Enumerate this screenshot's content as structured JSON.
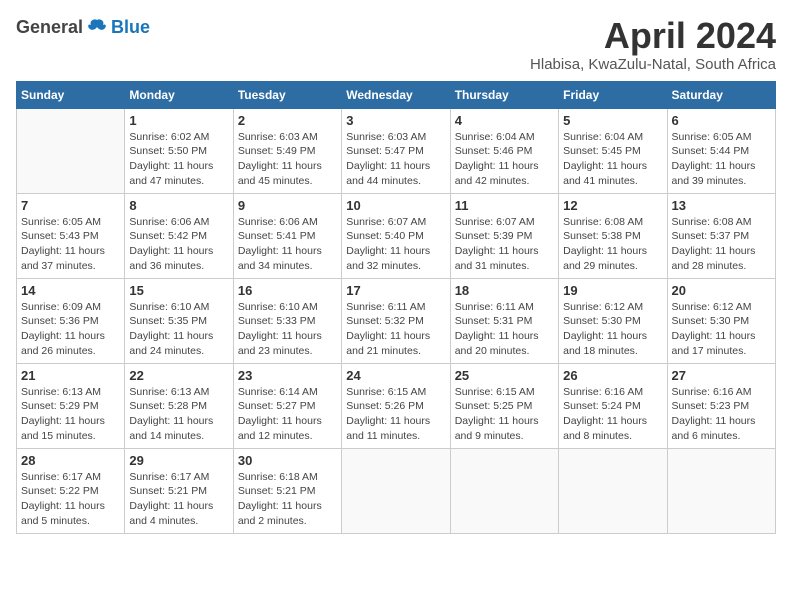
{
  "header": {
    "logo_general": "General",
    "logo_blue": "Blue",
    "month_title": "April 2024",
    "location": "Hlabisa, KwaZulu-Natal, South Africa"
  },
  "days_of_week": [
    "Sunday",
    "Monday",
    "Tuesday",
    "Wednesday",
    "Thursday",
    "Friday",
    "Saturday"
  ],
  "weeks": [
    [
      {
        "day": "",
        "info": ""
      },
      {
        "day": "1",
        "info": "Sunrise: 6:02 AM\nSunset: 5:50 PM\nDaylight: 11 hours\nand 47 minutes."
      },
      {
        "day": "2",
        "info": "Sunrise: 6:03 AM\nSunset: 5:49 PM\nDaylight: 11 hours\nand 45 minutes."
      },
      {
        "day": "3",
        "info": "Sunrise: 6:03 AM\nSunset: 5:47 PM\nDaylight: 11 hours\nand 44 minutes."
      },
      {
        "day": "4",
        "info": "Sunrise: 6:04 AM\nSunset: 5:46 PM\nDaylight: 11 hours\nand 42 minutes."
      },
      {
        "day": "5",
        "info": "Sunrise: 6:04 AM\nSunset: 5:45 PM\nDaylight: 11 hours\nand 41 minutes."
      },
      {
        "day": "6",
        "info": "Sunrise: 6:05 AM\nSunset: 5:44 PM\nDaylight: 11 hours\nand 39 minutes."
      }
    ],
    [
      {
        "day": "7",
        "info": "Sunrise: 6:05 AM\nSunset: 5:43 PM\nDaylight: 11 hours\nand 37 minutes."
      },
      {
        "day": "8",
        "info": "Sunrise: 6:06 AM\nSunset: 5:42 PM\nDaylight: 11 hours\nand 36 minutes."
      },
      {
        "day": "9",
        "info": "Sunrise: 6:06 AM\nSunset: 5:41 PM\nDaylight: 11 hours\nand 34 minutes."
      },
      {
        "day": "10",
        "info": "Sunrise: 6:07 AM\nSunset: 5:40 PM\nDaylight: 11 hours\nand 32 minutes."
      },
      {
        "day": "11",
        "info": "Sunrise: 6:07 AM\nSunset: 5:39 PM\nDaylight: 11 hours\nand 31 minutes."
      },
      {
        "day": "12",
        "info": "Sunrise: 6:08 AM\nSunset: 5:38 PM\nDaylight: 11 hours\nand 29 minutes."
      },
      {
        "day": "13",
        "info": "Sunrise: 6:08 AM\nSunset: 5:37 PM\nDaylight: 11 hours\nand 28 minutes."
      }
    ],
    [
      {
        "day": "14",
        "info": "Sunrise: 6:09 AM\nSunset: 5:36 PM\nDaylight: 11 hours\nand 26 minutes."
      },
      {
        "day": "15",
        "info": "Sunrise: 6:10 AM\nSunset: 5:35 PM\nDaylight: 11 hours\nand 24 minutes."
      },
      {
        "day": "16",
        "info": "Sunrise: 6:10 AM\nSunset: 5:33 PM\nDaylight: 11 hours\nand 23 minutes."
      },
      {
        "day": "17",
        "info": "Sunrise: 6:11 AM\nSunset: 5:32 PM\nDaylight: 11 hours\nand 21 minutes."
      },
      {
        "day": "18",
        "info": "Sunrise: 6:11 AM\nSunset: 5:31 PM\nDaylight: 11 hours\nand 20 minutes."
      },
      {
        "day": "19",
        "info": "Sunrise: 6:12 AM\nSunset: 5:30 PM\nDaylight: 11 hours\nand 18 minutes."
      },
      {
        "day": "20",
        "info": "Sunrise: 6:12 AM\nSunset: 5:30 PM\nDaylight: 11 hours\nand 17 minutes."
      }
    ],
    [
      {
        "day": "21",
        "info": "Sunrise: 6:13 AM\nSunset: 5:29 PM\nDaylight: 11 hours\nand 15 minutes."
      },
      {
        "day": "22",
        "info": "Sunrise: 6:13 AM\nSunset: 5:28 PM\nDaylight: 11 hours\nand 14 minutes."
      },
      {
        "day": "23",
        "info": "Sunrise: 6:14 AM\nSunset: 5:27 PM\nDaylight: 11 hours\nand 12 minutes."
      },
      {
        "day": "24",
        "info": "Sunrise: 6:15 AM\nSunset: 5:26 PM\nDaylight: 11 hours\nand 11 minutes."
      },
      {
        "day": "25",
        "info": "Sunrise: 6:15 AM\nSunset: 5:25 PM\nDaylight: 11 hours\nand 9 minutes."
      },
      {
        "day": "26",
        "info": "Sunrise: 6:16 AM\nSunset: 5:24 PM\nDaylight: 11 hours\nand 8 minutes."
      },
      {
        "day": "27",
        "info": "Sunrise: 6:16 AM\nSunset: 5:23 PM\nDaylight: 11 hours\nand 6 minutes."
      }
    ],
    [
      {
        "day": "28",
        "info": "Sunrise: 6:17 AM\nSunset: 5:22 PM\nDaylight: 11 hours\nand 5 minutes."
      },
      {
        "day": "29",
        "info": "Sunrise: 6:17 AM\nSunset: 5:21 PM\nDaylight: 11 hours\nand 4 minutes."
      },
      {
        "day": "30",
        "info": "Sunrise: 6:18 AM\nSunset: 5:21 PM\nDaylight: 11 hours\nand 2 minutes."
      },
      {
        "day": "",
        "info": ""
      },
      {
        "day": "",
        "info": ""
      },
      {
        "day": "",
        "info": ""
      },
      {
        "day": "",
        "info": ""
      }
    ]
  ]
}
